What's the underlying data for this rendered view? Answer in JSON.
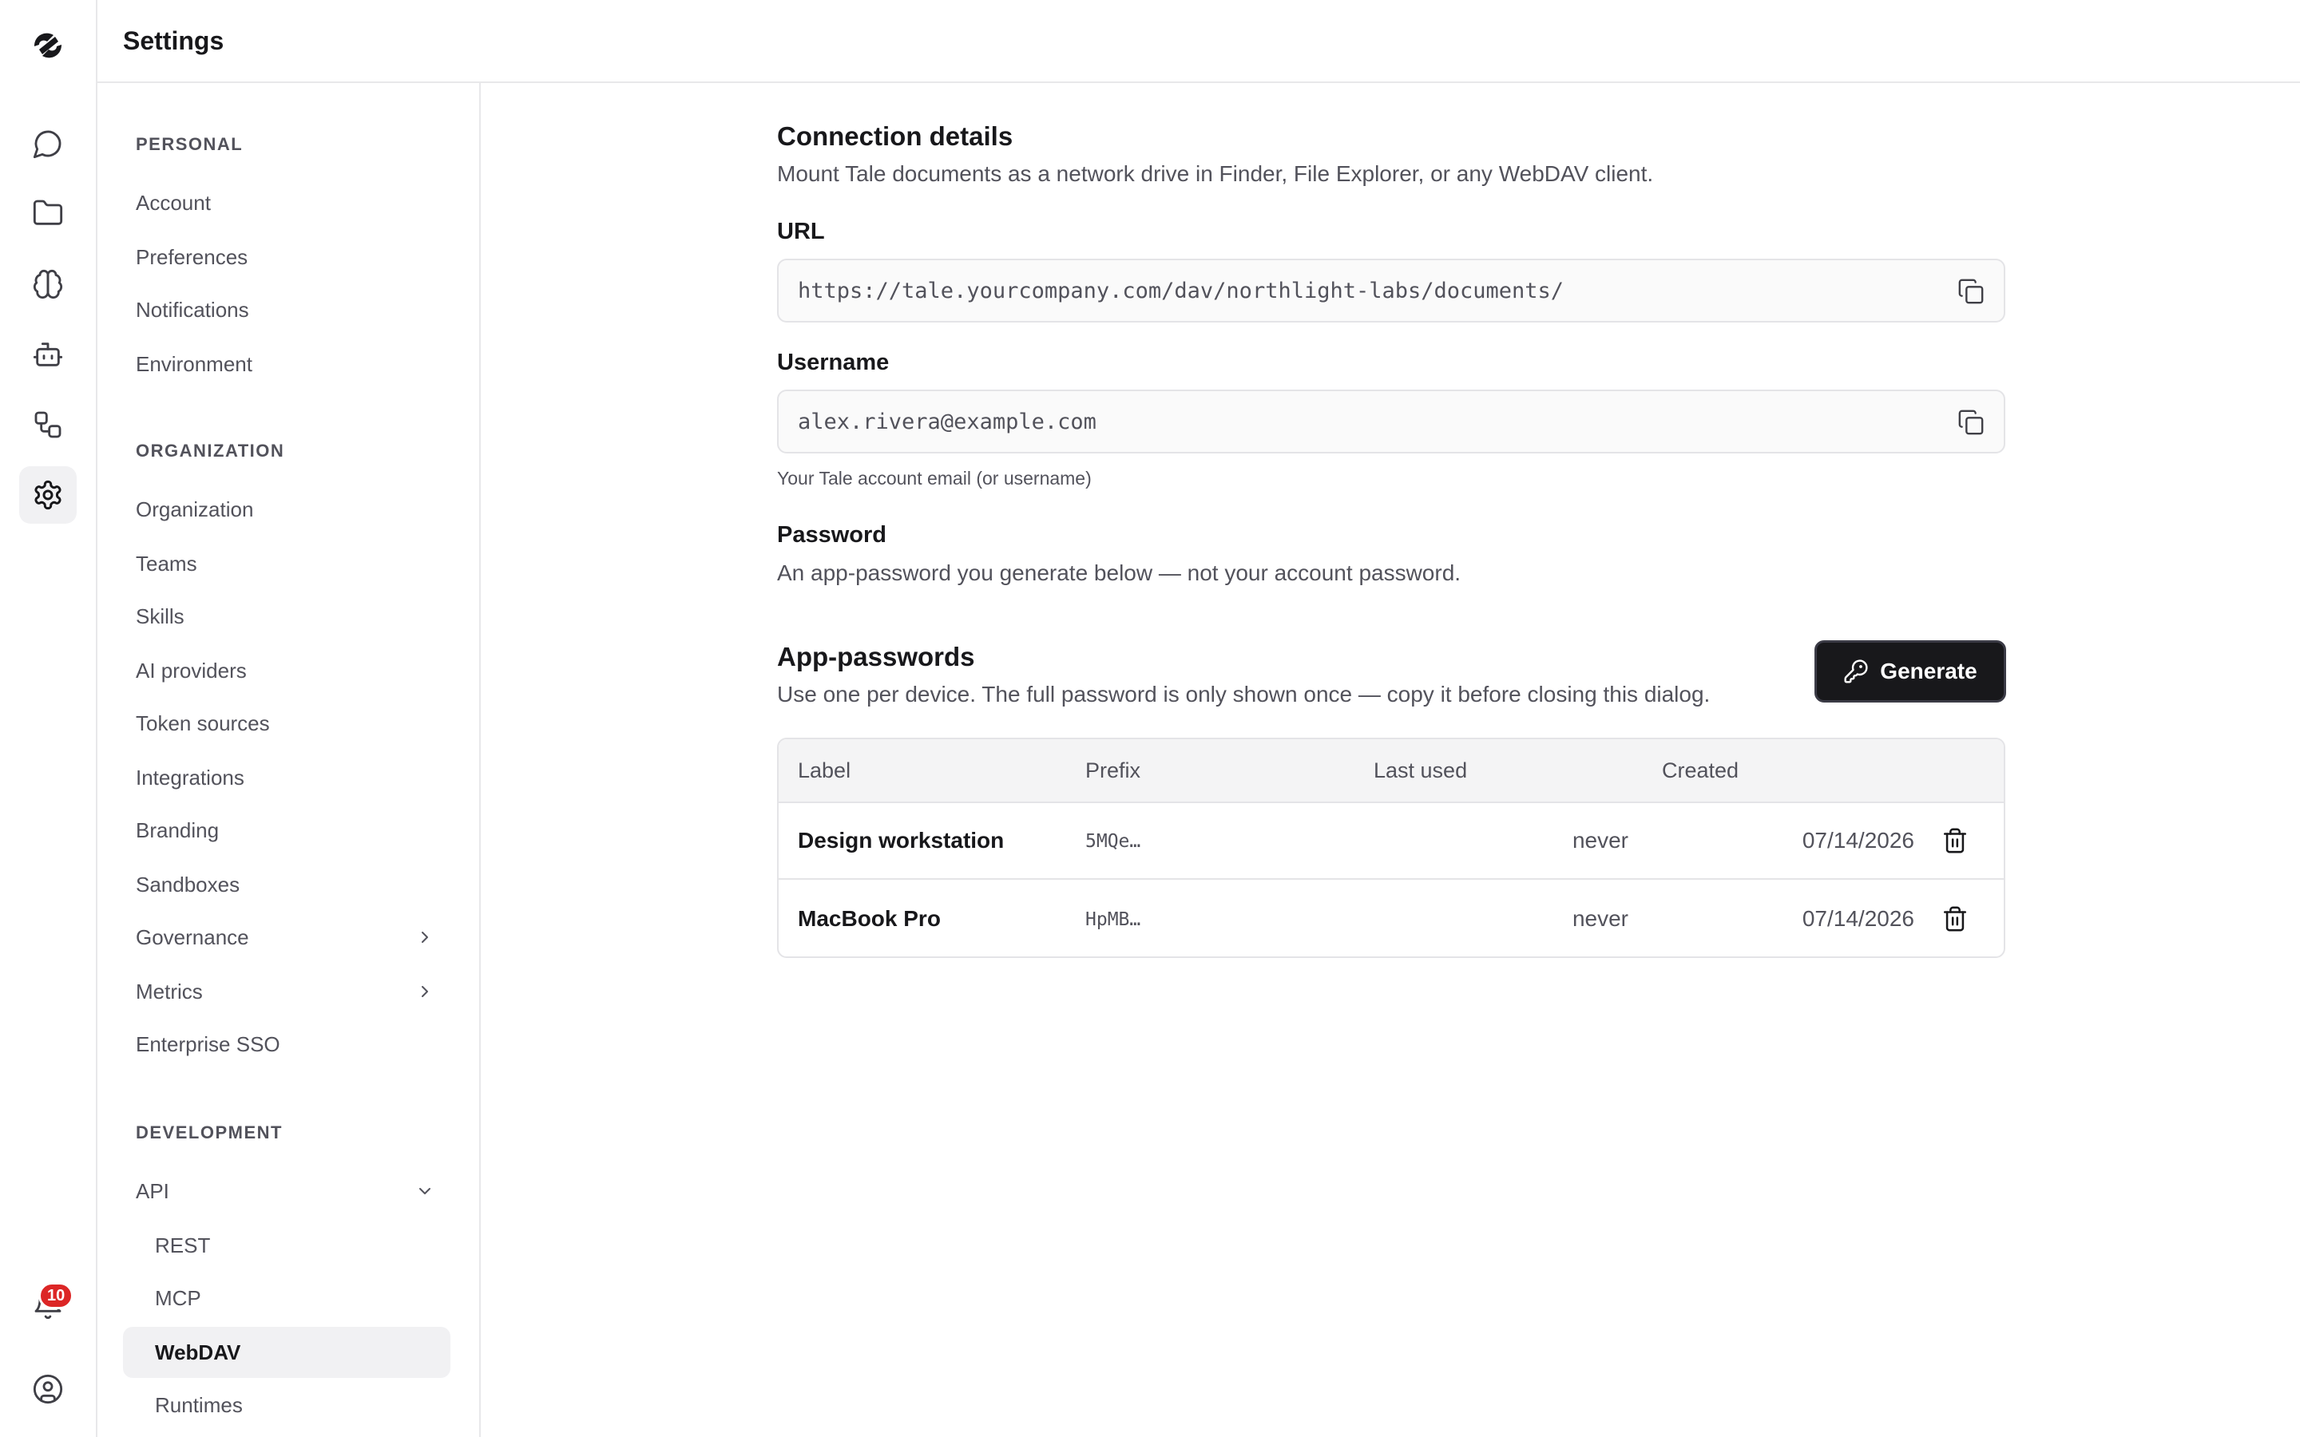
{
  "header": {
    "title": "Settings"
  },
  "notifications": {
    "count": "10"
  },
  "nav": {
    "personal": {
      "heading": "PERSONAL",
      "items": [
        "Account",
        "Preferences",
        "Notifications",
        "Environment"
      ]
    },
    "organization": {
      "heading": "ORGANIZATION",
      "items": [
        "Organization",
        "Teams",
        "Skills",
        "AI providers",
        "Token sources",
        "Integrations",
        "Branding",
        "Sandboxes",
        "Governance",
        "Metrics",
        "Enterprise SSO"
      ]
    },
    "development": {
      "heading": "DEVELOPMENT",
      "items": [
        "API",
        "REST",
        "MCP",
        "WebDAV",
        "Runtimes"
      ]
    },
    "active_item": "WebDAV"
  },
  "connection": {
    "title": "Connection details",
    "description": "Mount Tale documents as a network drive in Finder, File Explorer, or any WebDAV client.",
    "url_label": "URL",
    "url_value": "https://tale.yourcompany.com/dav/northlight-labs/documents/",
    "username_label": "Username",
    "username_value": "alex.rivera@example.com",
    "username_hint": "Your Tale account email (or username)",
    "password_label": "Password",
    "password_description": "An app-password you generate below — not your account password."
  },
  "app_passwords": {
    "title": "App-passwords",
    "description": "Use one per device. The full password is only shown once — copy it before closing this dialog.",
    "generate_label": "Generate",
    "columns": [
      "Label",
      "Prefix",
      "Last used",
      "Created"
    ],
    "rows": [
      {
        "label": "Design workstation",
        "prefix": "5MQe…",
        "last_used": "never",
        "created": "07/14/2026"
      },
      {
        "label": "MacBook Pro",
        "prefix": "HpMB…",
        "last_used": "never",
        "created": "07/14/2026"
      }
    ]
  },
  "colors": {
    "accent": "#18181b",
    "badge": "#dc2626",
    "muted_text": "#52525b",
    "border": "#e4e4e7"
  }
}
